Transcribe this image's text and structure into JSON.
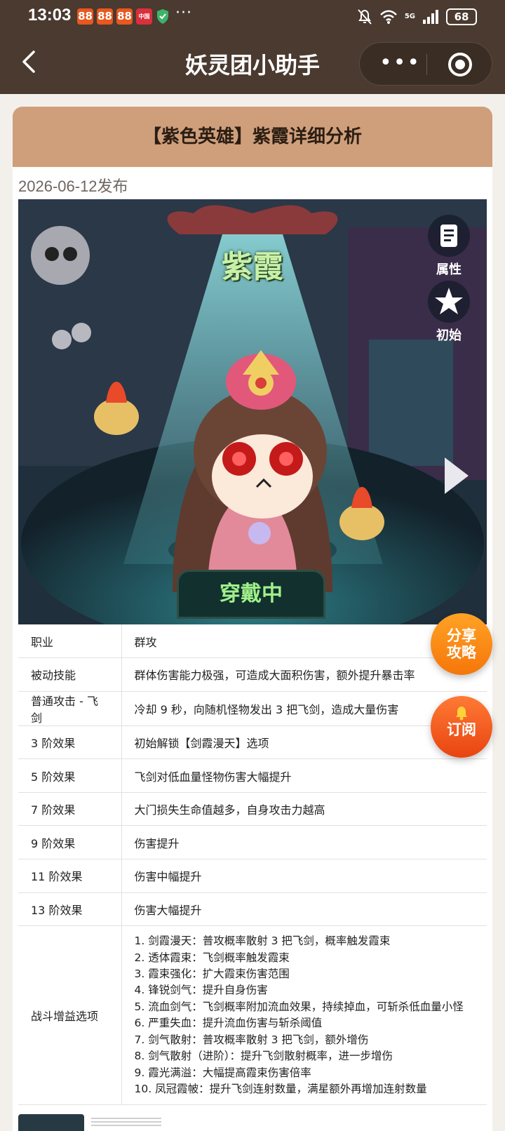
{
  "status_bar": {
    "time": "13:03",
    "notif_icons": [
      "88",
      "88",
      "88",
      "中国"
    ],
    "more": "···",
    "network": "5G",
    "battery": "68"
  },
  "header": {
    "title": "妖灵团小助手",
    "more_label": "•••"
  },
  "article": {
    "title": "【紫色英雄】紫霞详细分析",
    "date": "2026-06-12发布"
  },
  "hero": {
    "name": "紫霞",
    "attr_label": "属性",
    "init_label": "初始",
    "wearing_label": "穿戴中"
  },
  "table": {
    "rows": [
      {
        "key": "职业",
        "value": "群攻"
      },
      {
        "key": "被动技能",
        "value": "群体伤害能力极强，可造成大面积伤害，额外提升暴击率"
      },
      {
        "key": "普通攻击 - 飞剑",
        "value": "冷却 9 秒，向随机怪物发出 3 把飞剑，造成大量伤害"
      },
      {
        "key": "3 阶效果",
        "value": "初始解锁【剑霞漫天】选项"
      },
      {
        "key": "5 阶效果",
        "value": "飞剑对低血量怪物伤害大幅提升"
      },
      {
        "key": "7 阶效果",
        "value": "大门损失生命值越多，自身攻击力越高"
      },
      {
        "key": "9 阶效果",
        "value": "伤害提升"
      },
      {
        "key": "11 阶效果",
        "value": "伤害中幅提升"
      },
      {
        "key": "13 阶效果",
        "value": "伤害大幅提升"
      }
    ],
    "buff_key": "战斗增益选项",
    "buff_items": [
      "1. 剑霞漫天：普攻概率散射 3 把飞剑，概率触发霞束",
      "2. 透体霞束：飞剑概率触发霞束",
      "3. 霞束强化：扩大霞束伤害范围",
      "4. 锋锐剑气：提升自身伤害",
      "5. 流血剑气：飞剑概率附加流血效果，持续掉血，可斩杀低血量小怪",
      "6. 严重失血：提升流血伤害与斩杀阈值",
      "7. 剑气散射：普攻概率散射 3 把飞剑，额外增伤",
      "8. 剑气散射（进阶）：提升飞剑散射概率，进一步增伤",
      "9. 霞光满溢：大幅提高霞束伤害倍率",
      "10. 凤冠霞帔：提升飞剑连射数量，满星额外再增加连射数量"
    ]
  },
  "fabs": {
    "share": "分享攻略",
    "share_l1": "分享",
    "share_l2": "攻略",
    "subscribe": "订阅"
  },
  "colors": {
    "header_bg": "#4a3a30",
    "card_head_bg": "#cf9f7c",
    "fab_share": "#f5860f",
    "fab_sub": "#e8501a"
  }
}
